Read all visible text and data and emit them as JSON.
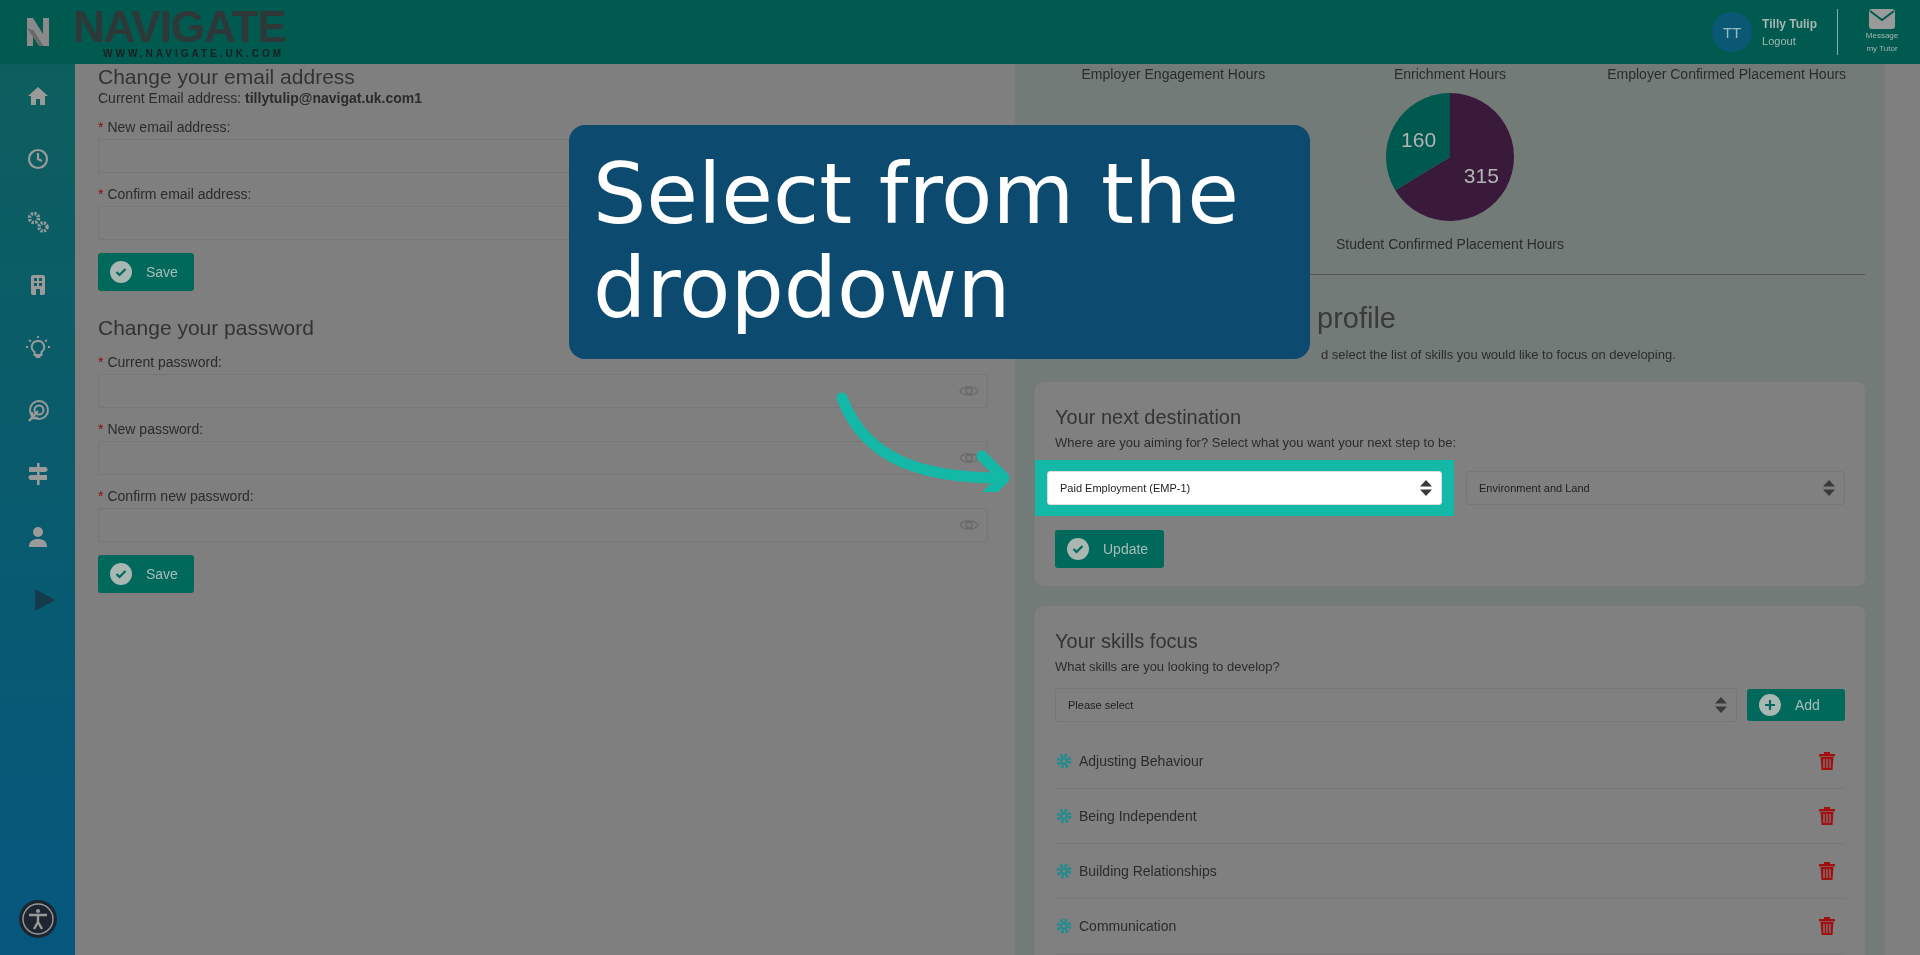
{
  "header": {
    "logo": "NAVIGATE",
    "logo_sub": "WWW.NAVIGATE.UK.COM",
    "user": {
      "initials": "TT",
      "name": "Tilly Tulip",
      "logout": "Logout"
    },
    "message": [
      "Message",
      "my Tutor"
    ]
  },
  "email_form": {
    "title": "Change your email address",
    "current_label": "Current Email address:",
    "current_value": "tillytulip@navigat.uk.com1",
    "fields": [
      {
        "mark": "*",
        "label": "New email address:"
      },
      {
        "mark": "*",
        "label": "Confirm email address:"
      }
    ],
    "button": "Save"
  },
  "password_form": {
    "title": "Change your password",
    "fields": [
      {
        "mark": "*",
        "label": "Current password:",
        "visibility_toggle": true
      },
      {
        "mark": "*",
        "label": "New password:",
        "visibility_toggle": true
      },
      {
        "mark": "*",
        "label": "Confirm new password:",
        "visibility_toggle": true
      }
    ],
    "button": "Save"
  },
  "hours": {
    "titles": [
      "Employer Engagement Hours",
      "Enrichment Hours",
      "Employer Confirmed Placement Hours"
    ],
    "chart_data": {
      "type": "pie",
      "values": [
        160,
        315
      ],
      "colors": [
        "#00594f",
        "#3a1a3a"
      ],
      "data_labels": true
    },
    "caption": "Student Confirmed Placement Hours"
  },
  "profile": {
    "title": "profile",
    "description": "d select the list of skills you would like to focus on developing."
  },
  "destination": {
    "title": "Your next destination",
    "prompt": "Where are you aiming for? Select what you want your next step to be:",
    "selects": [
      {
        "value": "Paid Employment (EMP-1)",
        "highlighted": true
      },
      {
        "value": "Environment and Land",
        "highlighted": false
      }
    ],
    "button": "Update"
  },
  "skills": {
    "title": "Your skills focus",
    "prompt": "What skills are you looking to develop?",
    "select": "Please select",
    "button": "Add",
    "items": [
      "Adjusting Behaviour",
      "Being Independent",
      "Building Relationships",
      "Communication"
    ]
  },
  "callout": {
    "text": "Select from the dropdown"
  }
}
